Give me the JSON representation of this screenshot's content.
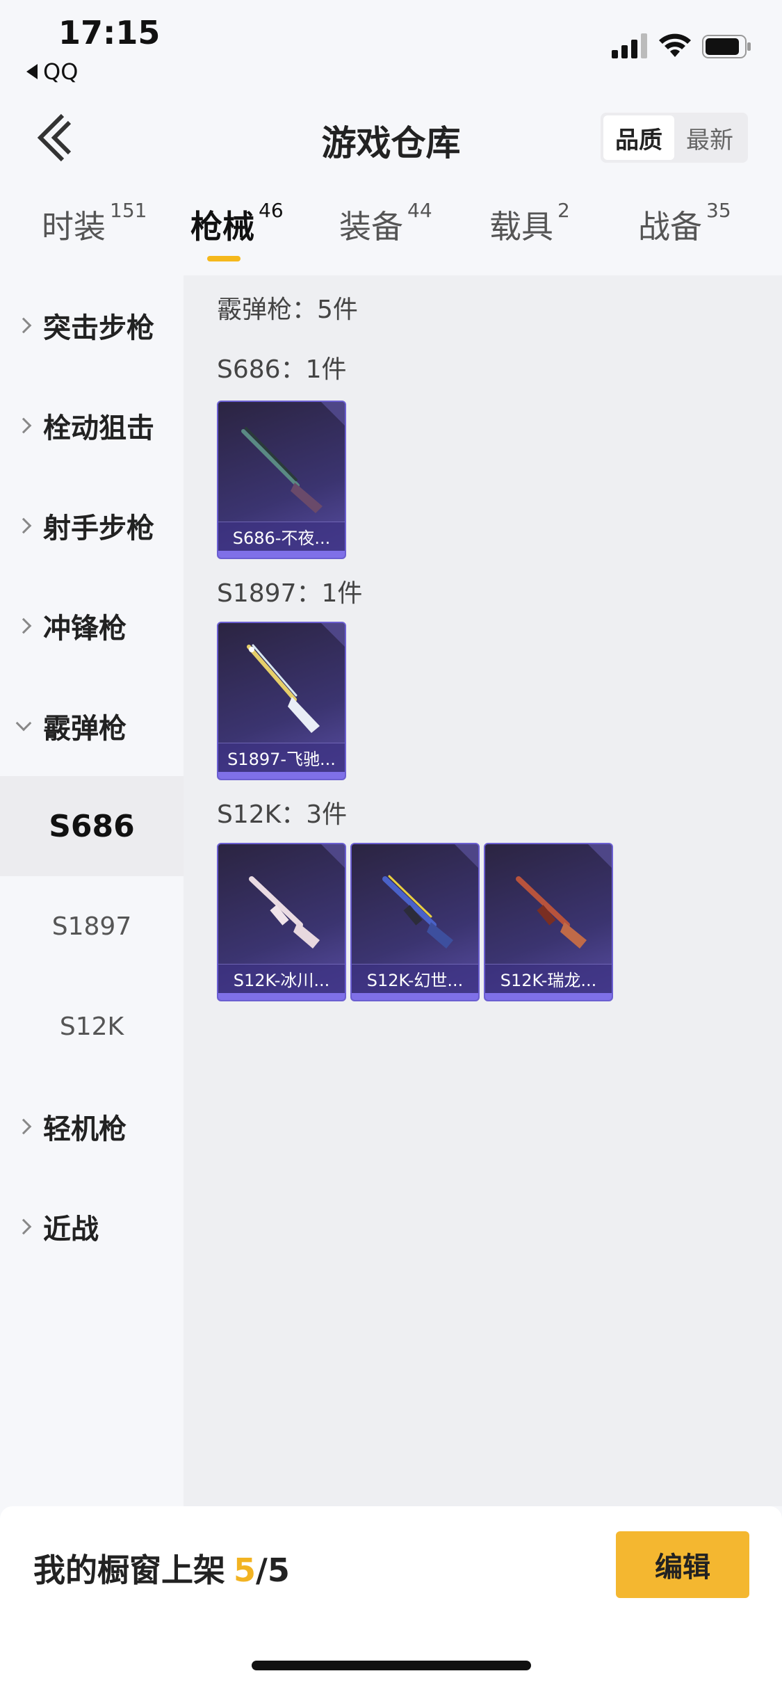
{
  "status": {
    "time": "17:15",
    "back_app": "QQ"
  },
  "nav": {
    "title": "游戏仓库",
    "sort_options": [
      "品质",
      "最新"
    ],
    "sort_active": "品质"
  },
  "tabs": [
    {
      "label": "时装",
      "count": "151"
    },
    {
      "label": "枪械",
      "count": "46"
    },
    {
      "label": "装备",
      "count": "44"
    },
    {
      "label": "载具",
      "count": "2"
    },
    {
      "label": "战备",
      "count": "35"
    }
  ],
  "sidebar": {
    "categories": [
      "突击步枪",
      "栓动狙击",
      "射手步枪",
      "冲锋枪",
      "霰弹枪",
      "轻机枪",
      "近战"
    ],
    "subitems": [
      "S686",
      "S1897",
      "S12K"
    ]
  },
  "content": {
    "summary": "霰弹枪：5件",
    "sections": [
      {
        "title": "S686：1件",
        "items": [
          "S686-不夜..."
        ]
      },
      {
        "title": "S1897：1件",
        "items": [
          "S1897-飞驰..."
        ]
      },
      {
        "title": "S12K：3件",
        "items": [
          "S12K-冰川...",
          "S12K-幻世...",
          "S12K-瑞龙..."
        ]
      }
    ]
  },
  "bottom": {
    "showcase_label": "我的橱窗上架",
    "showcase_count": "5",
    "showcase_slash": "/",
    "showcase_total": "5",
    "edit_label": "编辑"
  },
  "colors": {
    "accent": "#f4b730",
    "card_purple": "#3b3470"
  }
}
